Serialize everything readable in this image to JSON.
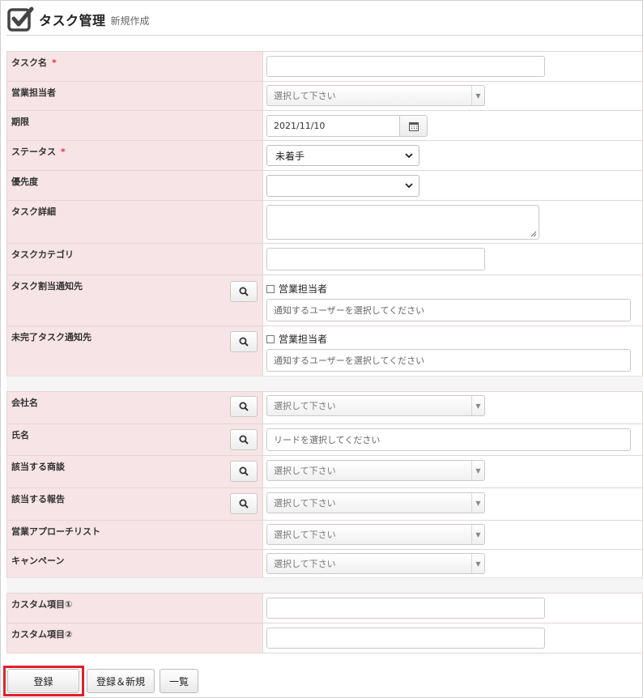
{
  "header": {
    "title": "タスク管理",
    "subtitle": "新規作成"
  },
  "fields": {
    "task_name": {
      "label": "タスク名",
      "required": "*",
      "value": ""
    },
    "sales_rep": {
      "label": "営業担当者",
      "placeholder": "選択して下さい"
    },
    "deadline": {
      "label": "期限",
      "value": "2021/11/10"
    },
    "status": {
      "label": "ステータス",
      "required": "*",
      "value": "未着手"
    },
    "priority": {
      "label": "優先度",
      "value": ""
    },
    "task_detail": {
      "label": "タスク詳細",
      "value": ""
    },
    "task_category": {
      "label": "タスクカテゴリ",
      "value": ""
    },
    "assign_notify": {
      "label": "タスク割当通知先",
      "checkbox_label": "営業担当者",
      "placeholder": "通知するユーザーを選択してください"
    },
    "incomplete_notify": {
      "label": "未完了タスク通知先",
      "checkbox_label": "営業担当者",
      "placeholder": "通知するユーザーを選択してください"
    },
    "company": {
      "label": "会社名",
      "placeholder": "選択して下さい"
    },
    "person_name": {
      "label": "氏名",
      "placeholder": "リードを選択してください"
    },
    "deal": {
      "label": "該当する商談",
      "placeholder": "選択して下さい"
    },
    "report": {
      "label": "該当する報告",
      "placeholder": "選択して下さい"
    },
    "approach_list": {
      "label": "営業アプローチリスト",
      "placeholder": "選択して下さい"
    },
    "campaign": {
      "label": "キャンペーン",
      "placeholder": "選択して下さい"
    },
    "custom1": {
      "label": "カスタム項目①",
      "value": ""
    },
    "custom2": {
      "label": "カスタム項目②",
      "value": ""
    }
  },
  "buttons": {
    "register": "登録",
    "register_new": "登録＆新規",
    "list": "一覧"
  },
  "colors": {
    "label_bg": "#f7e4e6",
    "required": "#e0334a",
    "highlight": "#e0202a"
  },
  "icons": {
    "logo": "checkbox-check-icon",
    "calendar": "calendar-icon",
    "search": "magnifier-icon"
  }
}
